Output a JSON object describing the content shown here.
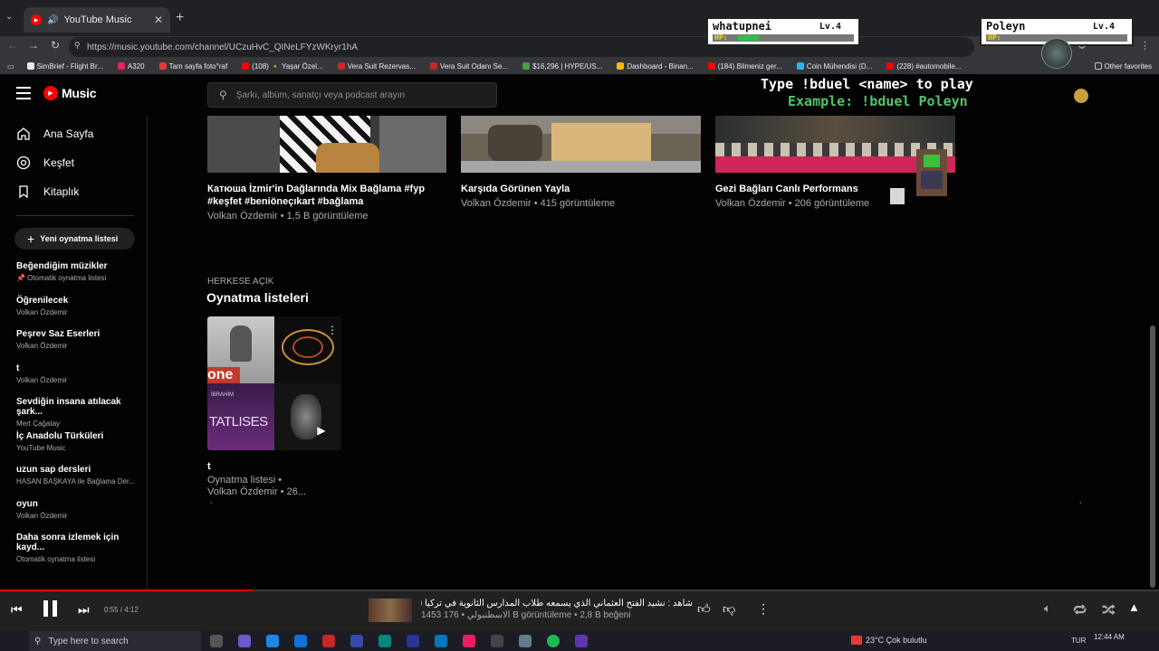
{
  "browser": {
    "tab_title": "YouTube Music",
    "url": "https://music.youtube.com/channel/UCzuHvC_QINeLFYzWKryr1hA",
    "bookmarks": [
      {
        "label": "SimBrief - Flight Br...",
        "color": "#e8eaed"
      },
      {
        "label": "A320",
        "color": "#e91e63"
      },
      {
        "label": "Tam sayfa foto°raf",
        "color": "#e53935"
      },
      {
        "label": "(108) 🔸 Yaşar Özel...",
        "color": "#ff0000"
      },
      {
        "label": "Vera Suit Rezervas...",
        "color": "#c62828"
      },
      {
        "label": "Vera Suit Odanı Se...",
        "color": "#c62828"
      },
      {
        "label": "$16,296 | HYPE/US...",
        "color": "#43a047"
      },
      {
        "label": "Dashboard - Binan...",
        "color": "#f0b90b"
      },
      {
        "label": "(184) Bilmeniz ger...",
        "color": "#ff0000"
      },
      {
        "label": "Coin Mühendisi (D...",
        "color": "#29b6f6"
      },
      {
        "label": "(228) #automobile...",
        "color": "#ff0000"
      }
    ],
    "other_favorites": "Other favorites"
  },
  "overlay": {
    "player1": {
      "name": "whatupnei",
      "level": "Lv.4",
      "hp_label": "HP:",
      "hp": 0.18
    },
    "player2": {
      "name": "Poleyn",
      "level": "Lv.4",
      "hp_label": "HP:",
      "hp": 0.0
    },
    "cmd_line1": "Type !bduel <name> to play",
    "cmd_line2": "Example: !bduel Poleyn"
  },
  "app": {
    "logo": "Music",
    "search_placeholder": "Şarkı, albüm, sanatçı veya podcast arayın",
    "nav": [
      {
        "label": "Ana Sayfa",
        "icon": "home-icon"
      },
      {
        "label": "Keşfet",
        "icon": "explore-icon"
      },
      {
        "label": "Kitaplık",
        "icon": "library-icon"
      }
    ],
    "new_playlist": "Yeni oynatma listesi",
    "playlists": [
      {
        "title": "Beğendiğim müzikler",
        "subtitle": "📌 Otomatik oynatma listesi"
      },
      {
        "title": "Öğrenilecek",
        "subtitle": "Volkan Özdemir"
      },
      {
        "title": "Peşrev Saz Eserleri",
        "subtitle": "Volkan Özdemir"
      },
      {
        "title": "t",
        "subtitle": "Volkan Özdemir"
      },
      {
        "title": "Sevdiğin insana atılacak şark...",
        "subtitle": "Mert Çağatay"
      },
      {
        "title": "İç Anadolu Türküleri",
        "subtitle": "YouTube Music"
      },
      {
        "title": "uzun sap dersleri",
        "subtitle": "HASAN BAŞKAYA ile Bağlama Der..."
      },
      {
        "title": "oyun",
        "subtitle": "Volkan Özdemir"
      },
      {
        "title": "Daha sonra izlemek için kayd...",
        "subtitle": "Otomatik oynatma listesi"
      }
    ]
  },
  "videos": [
    {
      "title": "Катюша İzmir'in Dağlarında Mix Bağlama #fyp #keşfet #beniöneçıkart #bağlama",
      "subtitle": "Volkan Özdemir • 1,5 B görüntüleme"
    },
    {
      "title": "Karşıda Görünen Yayla",
      "subtitle": "Volkan Özdemir • 415 görüntüleme"
    },
    {
      "title": "Gezi Bağları Canlı Performans",
      "subtitle": "Volkan Özdemir • 206 görüntüleme"
    }
  ],
  "section": {
    "kicker": "HERKESE AÇIK",
    "title": "Oynatma listeleri",
    "playlist_title": "t",
    "playlist_sub1": "Oynatma listesi •",
    "playlist_sub2": "Volkan Özdemir • 26...",
    "collage_text1": "one",
    "collage_text2": "TATLISES",
    "collage_text3": "İBRAHİM"
  },
  "player": {
    "time": "0:55 / 4:12",
    "progress": 0.218,
    "track_title": "شاهد : نشيد الفتح العثماني الذي يسمعه طلاب المدارس الثانوية في تركيا (مترجم العربية)",
    "track_meta": "1453 الاسطنبولي • 176 B görüntüleme • 2,8 B beğeni"
  },
  "taskbar": {
    "search": "Type here to search",
    "weather": "23°C  Çok bulutlu",
    "lang": "TUR",
    "time": "12:44 AM"
  }
}
